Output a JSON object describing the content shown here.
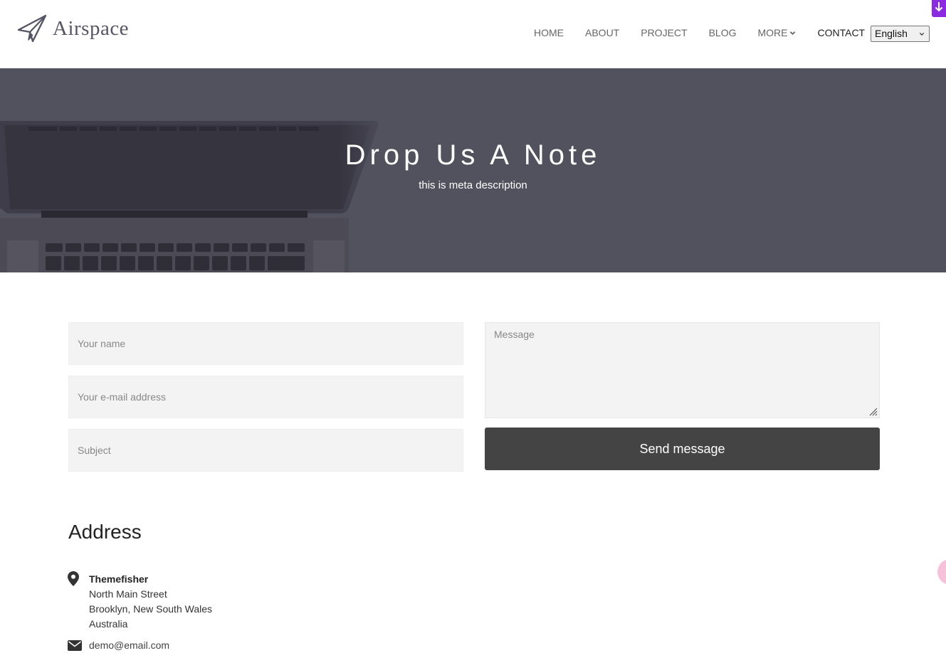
{
  "brand": {
    "name": "Airspace"
  },
  "nav": {
    "items": [
      {
        "label": "HOME",
        "active": false
      },
      {
        "label": "ABOUT",
        "active": false
      },
      {
        "label": "PROJECT",
        "active": false
      },
      {
        "label": "BLOG",
        "active": false
      },
      {
        "label": "MORE",
        "active": false,
        "has_dropdown": true
      },
      {
        "label": "CONTACT",
        "active": true
      }
    ],
    "language": {
      "selected": "English"
    }
  },
  "hero": {
    "title": "Drop Us A Note",
    "subtitle": "this is meta description"
  },
  "form": {
    "name_placeholder": "Your name",
    "email_placeholder": "Your e-mail address",
    "subject_placeholder": "Subject",
    "message_placeholder": "Message",
    "submit_label": "Send message"
  },
  "address": {
    "heading": "Address",
    "company": "Themefisher",
    "line1": "North Main Street",
    "line2": "Brooklyn, New South Wales",
    "line3": "Australia",
    "email": "demo@email.com"
  },
  "icons": {
    "logo": "paper-plane-icon",
    "more_dropdown": "chevron-down-icon",
    "corner": "arrow-down-icon",
    "location": "map-pin-icon",
    "email": "envelope-icon"
  },
  "colors": {
    "hero_bg": "#52515e",
    "button_bg": "#444444",
    "field_bg": "#f3f3f3",
    "corner_accent": "#8a2be2"
  }
}
